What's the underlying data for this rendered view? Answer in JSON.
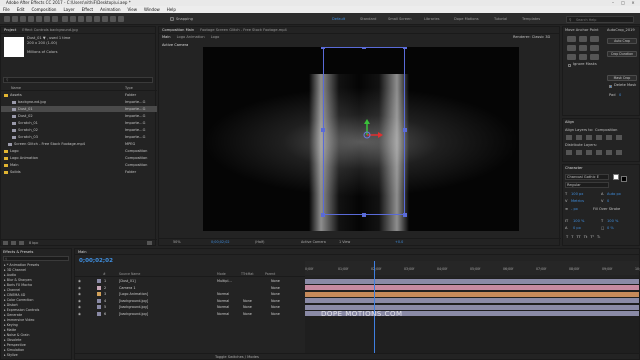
{
  "app": {
    "title": "Adobe After Effects CC 2017 - C:\\Users\\nithiF\\Desktop\\ui.aep *"
  },
  "menu": [
    "File",
    "Edit",
    "Composition",
    "Layer",
    "Effect",
    "Animation",
    "View",
    "Window",
    "Help"
  ],
  "toolbar": {
    "snapping_label": "Snapping",
    "workspaces": [
      "Default",
      "Standard",
      "Small Screen",
      "Libraries",
      "Dope Motions",
      "Tutorial",
      "Templates"
    ],
    "active_workspace": "Default",
    "search_placeholder": "Search Help"
  },
  "project_panel": {
    "tab": "Project",
    "fx_tab": "Effect Controls background.jpg",
    "selected_name": "Dust_01",
    "selected_info1": "Dust_01 ▼ , used 1 time",
    "selected_info2": "200 x 200 (1.00)",
    "selected_info3": "Millions of Colors",
    "search_placeholder": "",
    "col_name": "Name",
    "col_type": "Type",
    "items": [
      {
        "name": "Assets",
        "type": "Folder",
        "color": "#e0b431",
        "indent": 0
      },
      {
        "name": "background.jpg",
        "type": "Importe...G",
        "color": "#9a9aaa",
        "indent": 2
      },
      {
        "name": "Dust_01",
        "type": "Importe...G",
        "color": "#9a9aaa",
        "indent": 2
      },
      {
        "name": "Dust_02",
        "type": "Importe...G",
        "color": "#9a9aaa",
        "indent": 2
      },
      {
        "name": "Scratch_01",
        "type": "Importe...G",
        "color": "#9a9aaa",
        "indent": 2
      },
      {
        "name": "Scratch_02",
        "type": "Importe...G",
        "color": "#9a9aaa",
        "indent": 2
      },
      {
        "name": "Scratch_03",
        "type": "Importe...G",
        "color": "#9a9aaa",
        "indent": 2
      },
      {
        "name": "Screen Glitch - Free Stock Footage.mp4",
        "type": "MPEG",
        "color": "#9a9aaa",
        "indent": 1
      },
      {
        "name": "Logo",
        "type": "Composition",
        "color": "#e0b431",
        "indent": 0
      },
      {
        "name": "Logo Animation",
        "type": "Composition",
        "color": "#e0b431",
        "indent": 0
      },
      {
        "name": "Main",
        "type": "Composition",
        "color": "#e0b431",
        "indent": 0
      },
      {
        "name": "Solids",
        "type": "Folder",
        "color": "#e0b431",
        "indent": 0
      }
    ],
    "bpc_label": "8 bpc"
  },
  "composition_panel": {
    "tab_comp": "Composition Main",
    "tab_footage": "Footage Screen Glitch - Free Stock Footage.mp4",
    "subtabs": [
      "Main",
      "Logo Animation",
      "Logo"
    ],
    "renderer": "Renderer: Classic 3D",
    "active_camera": "Active Camera",
    "zoom": "50%",
    "timecode": "0;00;02;02",
    "resolution": "(Half)",
    "camera_select": "Active Camera",
    "view_select": "1 View",
    "exposure": "+0.0"
  },
  "right_panels": {
    "move_anchor_title": "Move Anchor Point",
    "autocrop_title": "AutoCrop_2019",
    "autocrop_btn": "Auto Crop",
    "crop_duration_btn": "Crop Duration",
    "ignore_masks": "Ignore Masks",
    "mask_crop_btn": "Mask Crop",
    "delete_mask": "Delete Mask",
    "pad_label": "Pad",
    "pad_value": "0",
    "align_title": "Align",
    "align_to_label": "Align Layers to:",
    "align_to_value": "Composition",
    "distribute_label": "Distribute Layers:",
    "character_title": "Character",
    "font_family": "Charcoal Gothic E",
    "font_style": "Regular",
    "font_size": "100 px",
    "leading": "Auto px",
    "tracking": "0",
    "metrics": "Metrics",
    "stroke": "- px",
    "stroke_type": "Fill Over Stroke",
    "vscale": "100 %",
    "hscale": "100 %",
    "baseline": "0 px",
    "tsume": "0 %"
  },
  "effects_panel": {
    "tab": "Effects & Presets",
    "items": [
      "* Animation Presets",
      "3D Channel",
      "Audio",
      "Blur & Sharpen",
      "Boris FX Mocha",
      "Channel",
      "CINEMA 4D",
      "Color Correction",
      "Distort",
      "Expression Controls",
      "Generate",
      "Immersive Video",
      "Keying",
      "Matte",
      "Noise & Grain",
      "Obsolete",
      "Perspective",
      "Simulation",
      "Stylize"
    ]
  },
  "timeline": {
    "tab": "Main",
    "timecode": "0;00;02;02",
    "header_cols": [
      "#",
      "Source Name",
      "Mode",
      "T",
      "TrkMat",
      "Parent"
    ],
    "layers": [
      {
        "num": "1",
        "name": "[Dust_01]",
        "mode": "Multipl…",
        "trkmat": "",
        "parent": "None",
        "color": "#8a8aa6",
        "bar": "#8a8aa6"
      },
      {
        "num": "2",
        "name": "Camera 1",
        "mode": "",
        "trkmat": "",
        "parent": "None",
        "color": "#c8a8b8",
        "bar": "#c68aa0"
      },
      {
        "num": "3",
        "name": "[Logo Animation]",
        "mode": "Normal",
        "trkmat": "",
        "parent": "None",
        "color": "#d4a25a",
        "bar": "#c68a5a"
      },
      {
        "num": "4",
        "name": "[background.jpg]",
        "mode": "Normal",
        "trkmat": "None",
        "parent": "None",
        "color": "#8a8aa6",
        "bar": "#8a8aa6"
      },
      {
        "num": "5",
        "name": "[background.jpg]",
        "mode": "Normal",
        "trkmat": "None",
        "parent": "None",
        "color": "#8a8aa6",
        "bar": "#8a8aa6"
      },
      {
        "num": "6",
        "name": "[background.jpg]",
        "mode": "Normal",
        "trkmat": "None",
        "parent": "None",
        "color": "#8a8aa6",
        "bar": "#8a8aa6"
      }
    ],
    "ruler_labels": [
      "0;00f",
      "01;00f",
      "02;00f",
      "03;00f",
      "04;00f",
      "05;00f",
      "06;00f",
      "07;00f",
      "08;00f",
      "09;00f",
      "10;0"
    ],
    "toggle_label": "Toggle Switches / Modes",
    "watermark": "DOPE MOTIONS.COM",
    "playhead_fraction": 0.206
  }
}
